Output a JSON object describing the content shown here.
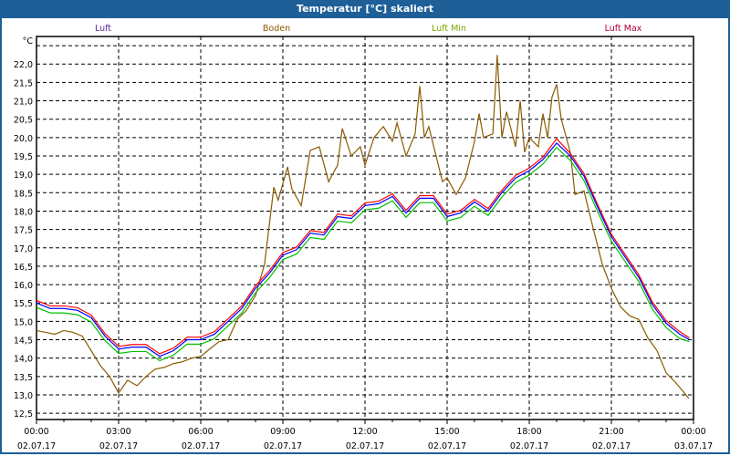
{
  "window_title": "Temperatur [°C] skaliert",
  "chart_data": {
    "type": "line",
    "title": "Temperatur [°C] skaliert",
    "ylabel": "°C",
    "xlabel": "",
    "ylim": [
      12.33,
      22.75
    ],
    "xlim_hours": [
      0,
      24
    ],
    "grid": true,
    "legend_placement": "top",
    "yticks": [
      "12,5",
      "13,0",
      "13,5",
      "14,0",
      "14,5",
      "15,0",
      "15,5",
      "16,0",
      "16,5",
      "17,0",
      "17,5",
      "18,0",
      "18,5",
      "19,0",
      "19,5",
      "20,0",
      "20,5",
      "21,0",
      "21,5",
      "22,0"
    ],
    "ytick_values": [
      12.5,
      13,
      13.5,
      14,
      14.5,
      15,
      15.5,
      16,
      16.5,
      17,
      17.5,
      18,
      18.5,
      19,
      19.5,
      20,
      20.5,
      21,
      21.5,
      22
    ],
    "xticks": [
      {
        "time": "00:00",
        "date": "02.07.17"
      },
      {
        "time": "03:00",
        "date": "02.07.17"
      },
      {
        "time": "06:00",
        "date": "02.07.17"
      },
      {
        "time": "09:00",
        "date": "02.07.17"
      },
      {
        "time": "12:00",
        "date": "02.07.17"
      },
      {
        "time": "15:00",
        "date": "02.07.17"
      },
      {
        "time": "18:00",
        "date": "02.07.17"
      },
      {
        "time": "21:00",
        "date": "02.07.17"
      },
      {
        "time": "00:00",
        "date": "03.07.17"
      }
    ],
    "series": [
      {
        "name": "Luft",
        "legend_color": "#5a2a9a",
        "color": "#0000ff",
        "x_step_hours": 0.5,
        "values": [
          15.5,
          15.35,
          15.35,
          15.3,
          15.1,
          14.6,
          14.25,
          14.3,
          14.3,
          14.05,
          14.2,
          14.5,
          14.5,
          14.65,
          15.0,
          15.35,
          15.9,
          16.3,
          16.8,
          16.95,
          17.4,
          17.35,
          17.85,
          17.8,
          18.15,
          18.2,
          18.4,
          17.95,
          18.35,
          18.35,
          17.85,
          17.95,
          18.25,
          18.0,
          18.5,
          18.9,
          19.1,
          19.4,
          19.85,
          19.5,
          18.95,
          18.1,
          17.3,
          16.75,
          16.2,
          15.45,
          14.95,
          14.65,
          14.5
        ]
      },
      {
        "name": "Boden",
        "legend_color": "#8b5a00",
        "color": "#8b5a00",
        "points": [
          [
            0,
            14.75
          ],
          [
            0.33,
            14.7
          ],
          [
            0.67,
            14.65
          ],
          [
            1,
            14.75
          ],
          [
            1.33,
            14.7
          ],
          [
            1.67,
            14.6
          ],
          [
            2,
            14.2
          ],
          [
            2.33,
            13.8
          ],
          [
            2.67,
            13.5
          ],
          [
            3,
            13.05
          ],
          [
            3.33,
            13.4
          ],
          [
            3.67,
            13.25
          ],
          [
            4,
            13.5
          ],
          [
            4.33,
            13.7
          ],
          [
            4.67,
            13.75
          ],
          [
            5,
            13.85
          ],
          [
            5.33,
            13.9
          ],
          [
            5.67,
            14.0
          ],
          [
            6,
            14.05
          ],
          [
            6.33,
            14.25
          ],
          [
            6.67,
            14.45
          ],
          [
            7,
            14.5
          ],
          [
            7.33,
            15.05
          ],
          [
            7.67,
            15.3
          ],
          [
            8,
            15.7
          ],
          [
            8.33,
            16.55
          ],
          [
            8.67,
            18.65
          ],
          [
            8.83,
            18.3
          ],
          [
            9.17,
            19.2
          ],
          [
            9.33,
            18.6
          ],
          [
            9.67,
            18.15
          ],
          [
            10,
            19.65
          ],
          [
            10.33,
            19.75
          ],
          [
            10.67,
            18.8
          ],
          [
            11,
            19.25
          ],
          [
            11.17,
            20.25
          ],
          [
            11.5,
            19.5
          ],
          [
            11.83,
            19.75
          ],
          [
            12,
            19.25
          ],
          [
            12.33,
            20.0
          ],
          [
            12.67,
            20.3
          ],
          [
            13,
            19.9
          ],
          [
            13.17,
            20.4
          ],
          [
            13.5,
            19.5
          ],
          [
            13.83,
            20.1
          ],
          [
            14,
            21.4
          ],
          [
            14.17,
            20.0
          ],
          [
            14.33,
            20.3
          ],
          [
            14.83,
            18.8
          ],
          [
            15,
            18.9
          ],
          [
            15.33,
            18.45
          ],
          [
            15.67,
            18.9
          ],
          [
            16,
            19.9
          ],
          [
            16.17,
            20.65
          ],
          [
            16.33,
            20.0
          ],
          [
            16.67,
            20.1
          ],
          [
            16.83,
            22.25
          ],
          [
            17,
            20.0
          ],
          [
            17.17,
            20.7
          ],
          [
            17.5,
            19.75
          ],
          [
            17.67,
            21.0
          ],
          [
            17.83,
            19.6
          ],
          [
            18,
            20.0
          ],
          [
            18.33,
            19.75
          ],
          [
            18.5,
            20.65
          ],
          [
            18.67,
            20.0
          ],
          [
            18.83,
            21.1
          ],
          [
            19,
            21.45
          ],
          [
            19.17,
            20.5
          ],
          [
            19.5,
            19.6
          ],
          [
            19.67,
            18.45
          ],
          [
            20,
            18.55
          ],
          [
            20.33,
            17.55
          ],
          [
            20.67,
            16.55
          ],
          [
            21,
            15.9
          ],
          [
            21.33,
            15.4
          ],
          [
            21.67,
            15.15
          ],
          [
            22,
            15.05
          ],
          [
            22.33,
            14.55
          ],
          [
            22.67,
            14.2
          ],
          [
            23,
            13.6
          ],
          [
            23.33,
            13.35
          ],
          [
            23.67,
            13.05
          ],
          [
            23.83,
            12.9
          ]
        ]
      },
      {
        "name": "Luft Min",
        "legend_color": "#7aa800",
        "color": "#00c000",
        "x_step_hours": 0.5,
        "values": [
          15.38,
          15.23,
          15.23,
          15.18,
          14.98,
          14.48,
          14.13,
          14.18,
          14.18,
          13.93,
          14.08,
          14.38,
          14.38,
          14.53,
          14.88,
          15.23,
          15.78,
          16.18,
          16.68,
          16.83,
          17.28,
          17.23,
          17.73,
          17.68,
          18.03,
          18.08,
          18.28,
          17.83,
          18.23,
          18.23,
          17.73,
          17.83,
          18.13,
          17.88,
          18.38,
          18.78,
          18.98,
          19.28,
          19.73,
          19.38,
          18.83,
          17.98,
          17.18,
          16.63,
          16.08,
          15.33,
          14.83,
          14.53,
          14.45
        ]
      },
      {
        "name": "Luft Max",
        "legend_color": "#b0003a",
        "color": "#ff0000",
        "x_step_hours": 0.5,
        "values": [
          15.57,
          15.42,
          15.42,
          15.37,
          15.17,
          14.67,
          14.32,
          14.37,
          14.37,
          14.12,
          14.27,
          14.57,
          14.57,
          14.72,
          15.07,
          15.42,
          15.97,
          16.37,
          16.87,
          17.02,
          17.47,
          17.42,
          17.92,
          17.87,
          18.22,
          18.27,
          18.47,
          18.02,
          18.42,
          18.42,
          17.92,
          18.02,
          18.32,
          18.07,
          18.57,
          18.97,
          19.17,
          19.47,
          19.97,
          19.57,
          19.02,
          18.17,
          17.37,
          16.82,
          16.27,
          15.52,
          15.02,
          14.72,
          14.55
        ]
      }
    ]
  }
}
